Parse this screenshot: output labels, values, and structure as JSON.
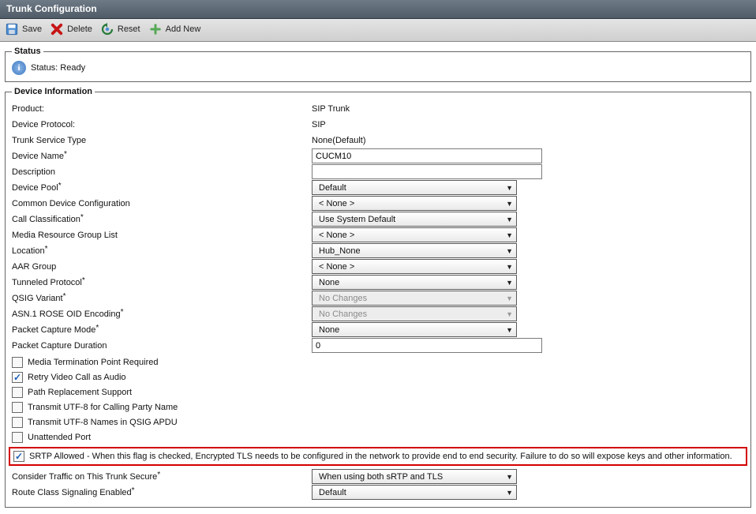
{
  "title": "Trunk Configuration",
  "toolbar": {
    "save": "Save",
    "delete": "Delete",
    "reset": "Reset",
    "addnew": "Add New"
  },
  "status": {
    "legend": "Status",
    "text": "Status: Ready"
  },
  "device": {
    "legend": "Device Information",
    "product_label": "Product:",
    "product_value": "SIP Trunk",
    "protocol_label": "Device Protocol:",
    "protocol_value": "SIP",
    "trunk_service_label": "Trunk Service Type",
    "trunk_service_value": "None(Default)",
    "device_name_label": "Device Name",
    "device_name_value": "CUCM10",
    "description_label": "Description",
    "description_value": "",
    "device_pool_label": "Device Pool",
    "device_pool_value": "Default",
    "common_device_label": "Common Device Configuration",
    "common_device_value": "< None >",
    "call_class_label": "Call Classification",
    "call_class_value": "Use System Default",
    "mrgl_label": "Media Resource Group List",
    "mrgl_value": "< None >",
    "location_label": "Location",
    "location_value": "Hub_None",
    "aar_label": "AAR Group",
    "aar_value": "< None >",
    "tunneled_label": "Tunneled Protocol",
    "tunneled_value": "None",
    "qsig_label": "QSIG Variant",
    "qsig_value": "No Changes",
    "asn1_label": "ASN.1 ROSE OID Encoding",
    "asn1_value": "No Changes",
    "pcap_mode_label": "Packet Capture Mode",
    "pcap_mode_value": "None",
    "pcap_dur_label": "Packet Capture Duration",
    "pcap_dur_value": "0",
    "chk_mtp": "Media Termination Point Required",
    "chk_retry": "Retry Video Call as Audio",
    "chk_path": "Path Replacement Support",
    "chk_utf8_calling": "Transmit UTF-8 for Calling Party Name",
    "chk_utf8_qsig": "Transmit UTF-8 Names in QSIG APDU",
    "chk_unattended": "Unattended Port",
    "chk_srtp": "SRTP Allowed - When this flag is checked, Encrypted TLS needs to be configured in the network to provide end to end security. Failure to do so will expose keys and other information.",
    "consider_traffic_label": "Consider Traffic on This Trunk Secure",
    "consider_traffic_value": "When using both sRTP and TLS",
    "route_class_label": "Route Class Signaling Enabled",
    "route_class_value": "Default"
  }
}
